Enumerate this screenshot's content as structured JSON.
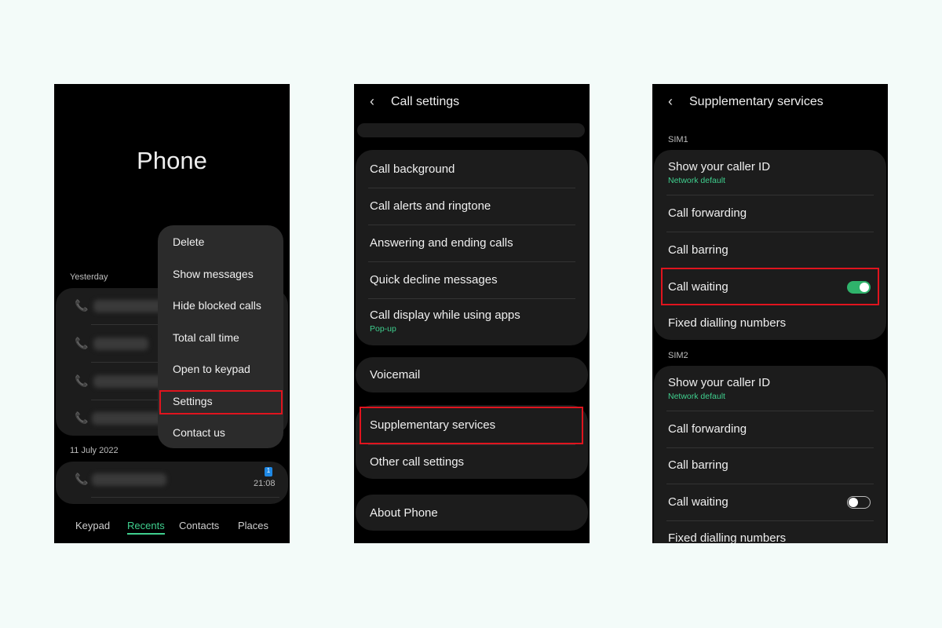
{
  "phone": {
    "title": "Phone",
    "yesterday_label": "Yesterday",
    "date_label": "11 July 2022",
    "menu": [
      "Delete",
      "Show messages",
      "Hide blocked calls",
      "Total call time",
      "Open to keypad",
      "Settings",
      "Contact us"
    ],
    "highlighted_menu_item": "Settings",
    "call_time": "21:08",
    "sim_badge": "1",
    "tabs": [
      "Keypad",
      "Recents",
      "Contacts",
      "Places"
    ],
    "active_tab": "Recents",
    "accent": "#3fcf8e"
  },
  "call_settings": {
    "title": "Call settings",
    "group1": [
      {
        "label": "Call background"
      },
      {
        "label": "Call alerts and ringtone"
      },
      {
        "label": "Answering and ending calls"
      },
      {
        "label": "Quick decline messages"
      },
      {
        "label": "Call display while using apps",
        "sub": "Pop-up"
      }
    ],
    "voicemail": "Voicemail",
    "group3": [
      "Supplementary services",
      "Other call settings"
    ],
    "about": "About Phone"
  },
  "supplementary": {
    "title": "Supplementary services",
    "sim1": {
      "label": "SIM1",
      "caller_id": "Show your caller ID",
      "caller_id_sub": "Network default",
      "forwarding": "Call forwarding",
      "barring": "Call barring",
      "waiting": "Call waiting",
      "waiting_on": true,
      "fdn": "Fixed dialling numbers"
    },
    "sim2": {
      "label": "SIM2",
      "caller_id": "Show your caller ID",
      "caller_id_sub": "Network default",
      "forwarding": "Call forwarding",
      "barring": "Call barring",
      "waiting": "Call waiting",
      "waiting_on": false,
      "fdn": "Fixed dialling numbers"
    },
    "highlight_color": "#e0141e"
  }
}
